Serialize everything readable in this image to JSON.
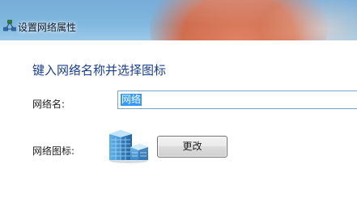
{
  "window": {
    "title": "设置网络属性",
    "icon": "network-icon"
  },
  "main": {
    "heading": "键入网络名称并选择图标",
    "network_name_label": "网络名:",
    "network_name_value": "网络",
    "network_icon_label": "网络图标:",
    "network_icon": "office-building-icon",
    "change_button_label": "更改"
  },
  "colors": {
    "heading": "#1a3f8f",
    "selection": "#3399ff",
    "input_border": "#7fa3c7"
  }
}
